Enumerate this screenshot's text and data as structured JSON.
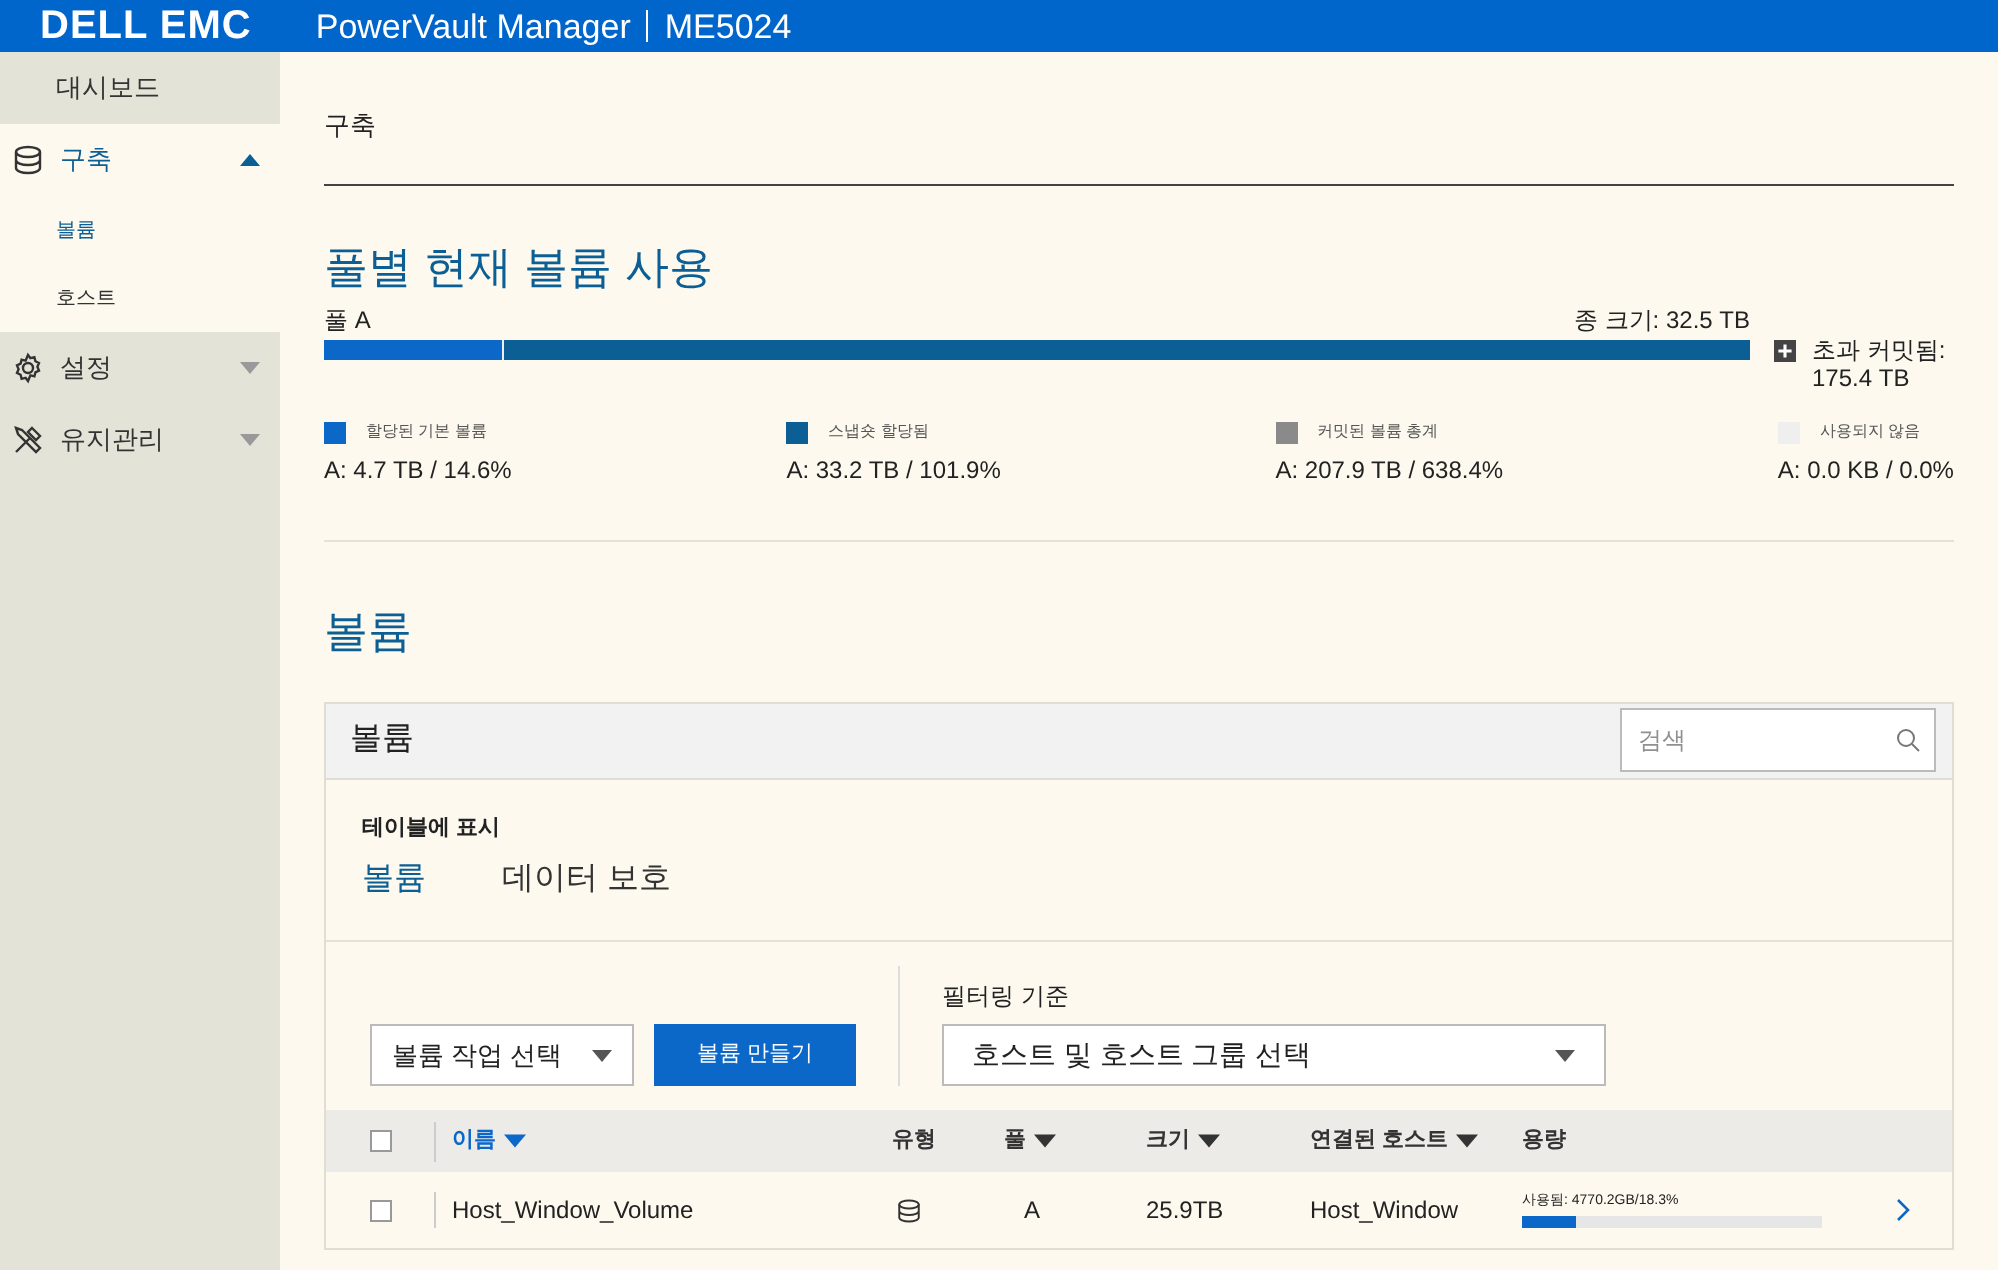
{
  "header": {
    "logo": "DELL EMC",
    "product": "PowerVault Manager",
    "model": "ME5024"
  },
  "sidebar": {
    "items": [
      {
        "label": "대시보드",
        "selected": false,
        "expanded": false
      },
      {
        "label": "구축",
        "selected": true,
        "expanded": true,
        "children": [
          {
            "label": "볼륨",
            "selected": true
          },
          {
            "label": "호스트",
            "selected": false
          }
        ]
      },
      {
        "label": "설정",
        "selected": false,
        "expanded": false
      },
      {
        "label": "유지관리",
        "selected": false,
        "expanded": false
      }
    ]
  },
  "breadcrumb": "구축",
  "usage": {
    "title": "풀별 현재 볼륨 사용",
    "pool_label": "풀 A",
    "total": "종 크기: 32.5 TB",
    "overcommit": "초과 커밋됨:\n175.4 TB",
    "segments": [
      {
        "level": 0.125,
        "color": "#0b67c8"
      },
      {
        "level": 0.875,
        "color": "#0b5f94"
      }
    ],
    "legend": [
      {
        "label": "할당된 기본 볼륨",
        "value": "A: 4.7 TB / 14.6%",
        "color": "#0b67c8"
      },
      {
        "label": "스냅숏 할당됨",
        "value": "A: 33.2 TB / 101.9%",
        "color": "#0b5f94"
      },
      {
        "label": "커밋된 볼륨 총계",
        "value": "A: 207.9 TB / 638.4%",
        "color": "#8a8a8a"
      },
      {
        "label": "사용되지 않음",
        "value": "A: 0.0 KB / 0.0%",
        "color": "#efefef"
      }
    ]
  },
  "volumes": {
    "title": "볼륨",
    "panel_title": "볼륨",
    "search": {
      "placeholder": "검색"
    },
    "show_label": "테이블에 표시",
    "tabs": [
      {
        "label": "볼륨",
        "selected": true
      },
      {
        "label": "데이터 보호",
        "selected": false
      }
    ],
    "action_select": "볼륨 작업 선택",
    "create_button": "볼륨 만들기",
    "filter_label": "필터링 기준",
    "filter_select": "호스트 및 호스트 그룹 선택",
    "select_all": {
      "checked": false
    },
    "columns": [
      {
        "label": "이름",
        "sortable": true,
        "selected": true
      },
      {
        "label": "유형",
        "sortable": false,
        "selected": false
      },
      {
        "label": "풀",
        "sortable": true,
        "selected": false
      },
      {
        "label": "크기",
        "sortable": true,
        "selected": false
      },
      {
        "label": "연결된 호스트",
        "sortable": true,
        "selected": false
      },
      {
        "label": "용량",
        "sortable": false,
        "selected": false
      }
    ],
    "rows": [
      {
        "checked": false,
        "name": "Host_Window_Volume",
        "pool": "A",
        "size": "25.9TB",
        "host": "Host_Window",
        "used": "사용됨: 4770.2GB/18.3%",
        "level": 0.183
      }
    ]
  }
}
